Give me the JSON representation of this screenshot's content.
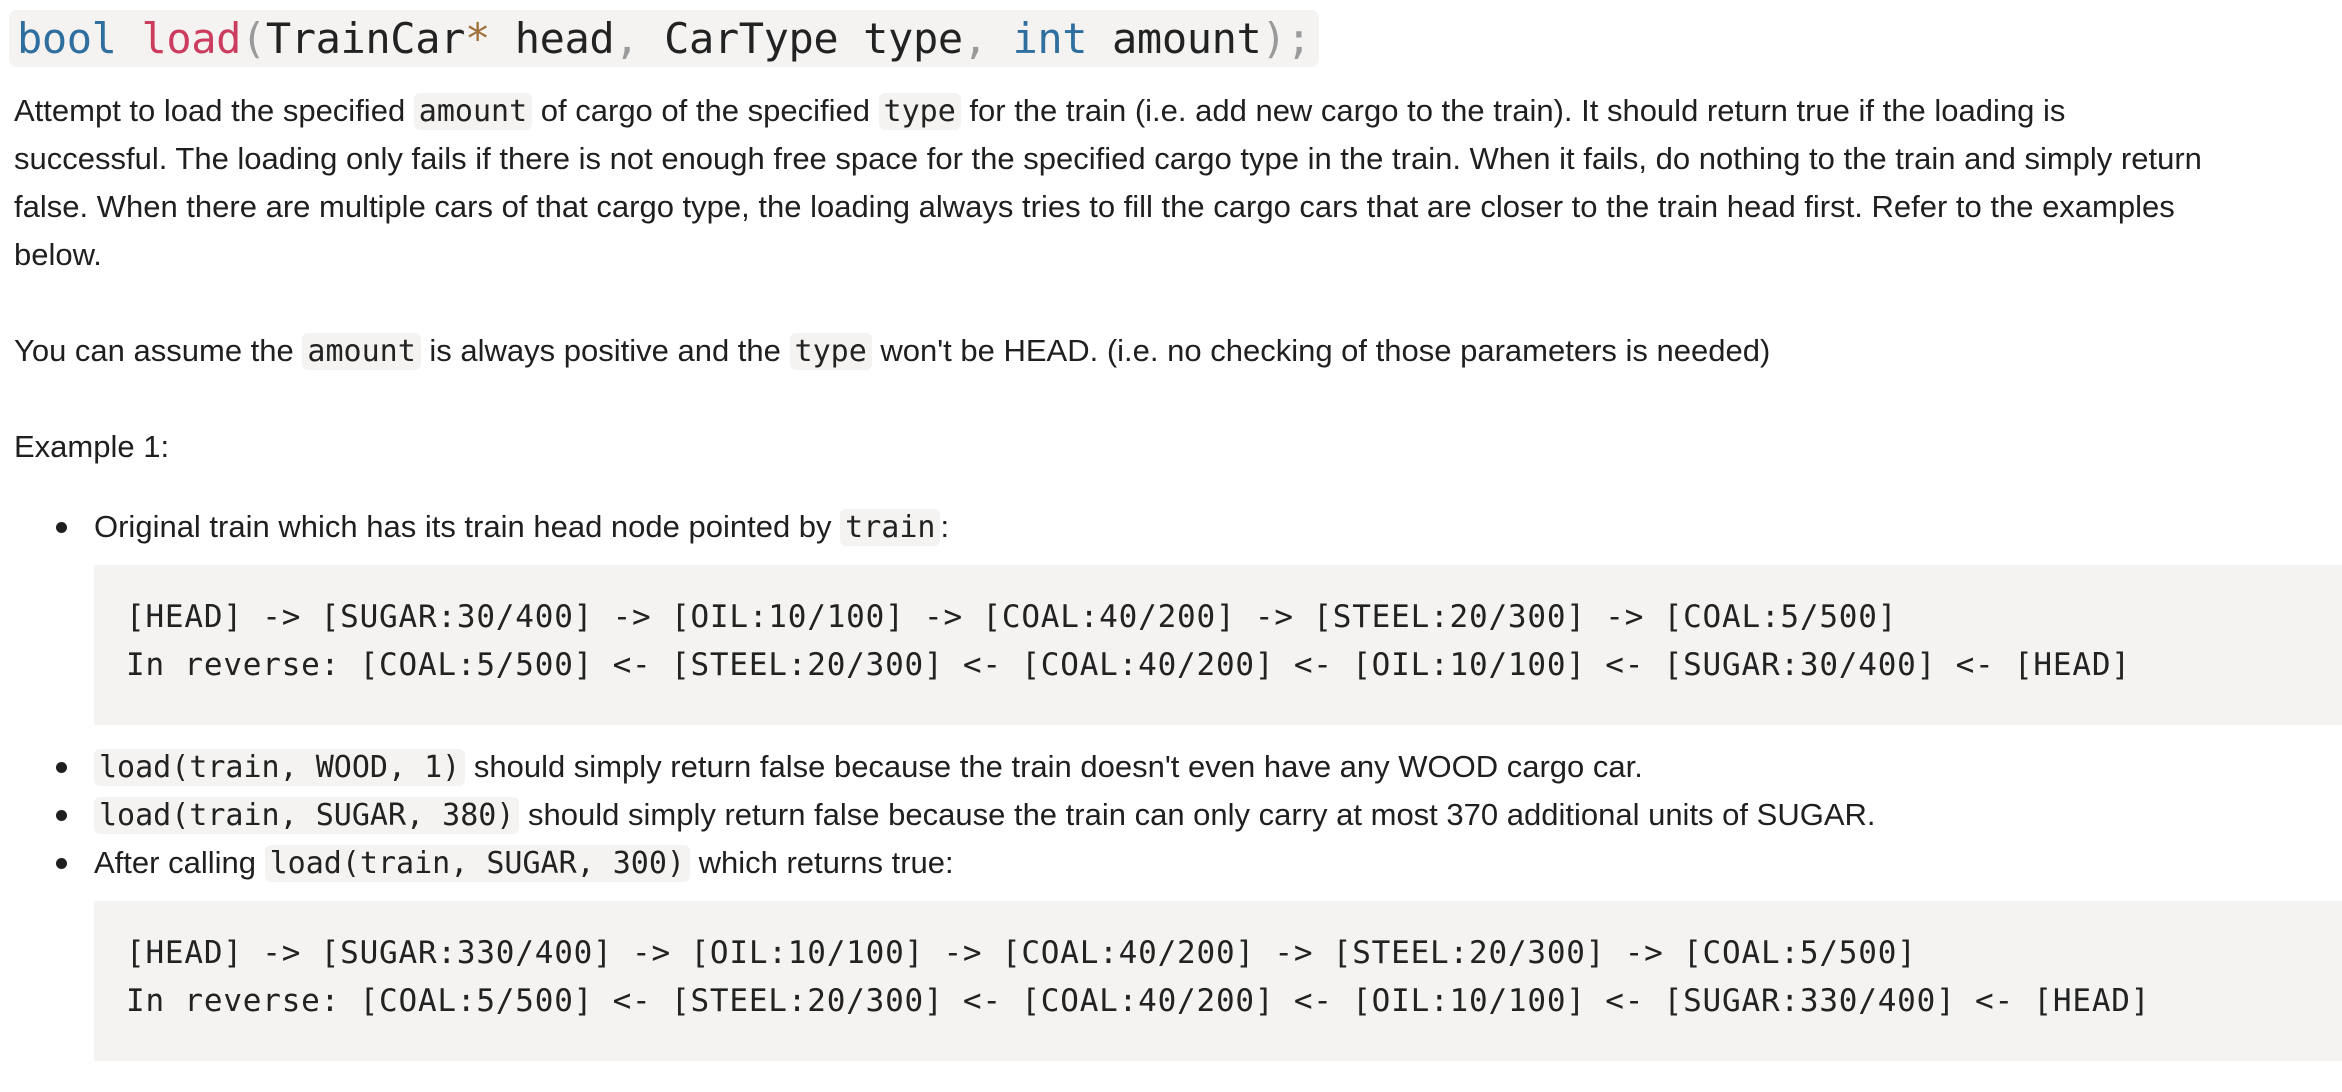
{
  "signature": {
    "return_type": "bool",
    "name": "load",
    "open_paren": "(",
    "p1_type": "TrainCar",
    "p1_star": "*",
    "p1_name": " head",
    "comma1": ",",
    "p2_type": " CarType",
    "p2_name": " type",
    "comma2": ",",
    "p3_type": " int",
    "p3_name": " amount",
    "close": ");"
  },
  "description": {
    "l1_a": "Attempt to load the specified ",
    "l1_code1": "amount",
    "l1_b": " of cargo of the specified ",
    "l1_code2": "type",
    "l1_c": " for the train (i.e. add new cargo to the train). It should return true if the loading is",
    "l2": "successful. The loading only fails if there is not enough free space for the specified cargo type in the train. When it fails, do nothing to the train and simply return",
    "l3": "false. When there are multiple cars of that cargo type, the loading always tries to fill the cargo cars that are closer to the train head first. Refer to the examples",
    "l4": "below."
  },
  "assumption": {
    "a": "You can assume the ",
    "code1": "amount",
    "b": " is always positive and the ",
    "code2": "type",
    "c": " won't be HEAD. (i.e. no checking of those parameters is needed)"
  },
  "example_title": "Example 1:",
  "items": {
    "b1_text": "Original train which has its train head node pointed by ",
    "b1_code": "train",
    "b1_tail": ":",
    "block1_l1": "[HEAD] -> [SUGAR:30/400] -> [OIL:10/100] -> [COAL:40/200] -> [STEEL:20/300] -> [COAL:5/500]",
    "block1_l2": "In reverse: [COAL:5/500] <- [STEEL:20/300] <- [COAL:40/200] <- [OIL:10/100] <- [SUGAR:30/400] <- [HEAD]",
    "b2_code": "load(train, WOOD, 1)",
    "b2_text": " should simply return false because the train doesn't even have any WOOD cargo car.",
    "b3_code": "load(train, SUGAR, 380)",
    "b3_text": " should simply return false because the train can only carry at most 370 additional units of SUGAR.",
    "b4_text": "After calling ",
    "b4_code": "load(train, SUGAR, 300)",
    "b4_tail": " which returns true:",
    "block2_l1": "[HEAD] -> [SUGAR:330/400] -> [OIL:10/100] -> [COAL:40/200] -> [STEEL:20/300] -> [COAL:5/500]",
    "block2_l2": "In reverse: [COAL:5/500] <- [STEEL:20/300] <- [COAL:40/200] <- [OIL:10/100] <- [SUGAR:330/400] <- [HEAD]"
  }
}
